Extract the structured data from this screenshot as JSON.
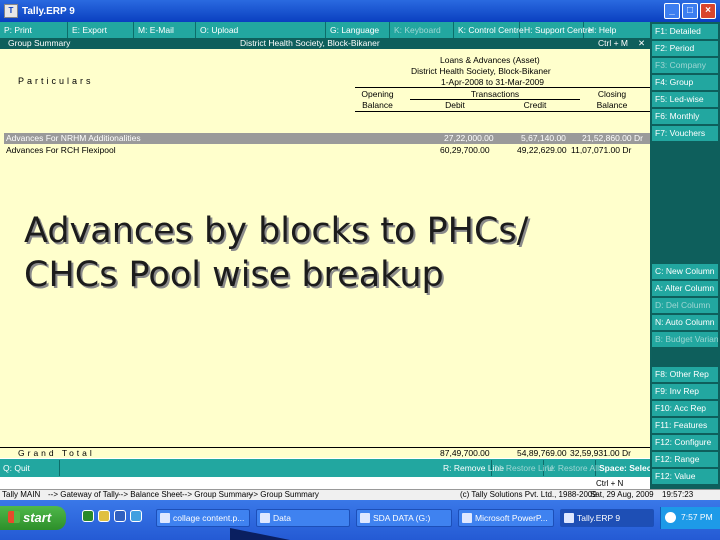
{
  "window": {
    "title": "Tally.ERP 9",
    "buttons": [
      "_",
      "□",
      "×"
    ]
  },
  "top_menu": [
    {
      "label": "P: Print",
      "dim": false
    },
    {
      "label": "E: Export",
      "dim": false
    },
    {
      "label": "M: E-Mail",
      "dim": false
    },
    {
      "label": "O: Upload",
      "dim": false
    },
    {
      "label": "G: Language",
      "dim": false
    },
    {
      "label": "K: Keyboard",
      "dim": true
    },
    {
      "label": "K: Control Centre",
      "dim": false
    },
    {
      "label": "H: Support Centre",
      "dim": false
    },
    {
      "label": "H: Help",
      "dim": false
    }
  ],
  "report_header": {
    "left": "Group Summary",
    "center": "District Health Society, Block-Bikaner",
    "right": "Ctrl + M",
    "close": "✕"
  },
  "report": {
    "particulars_label": "Particulars",
    "group_title": "Loans & Advances (Asset)",
    "company": "District Health Society, Block-Bikaner",
    "period": "1-Apr-2008 to 31-Mar-2009",
    "col_opening_1": "Opening",
    "col_opening_2": "Balance",
    "col_transactions": "Transactions",
    "col_debit": "Debit",
    "col_credit": "Credit",
    "col_closing_1": "Closing",
    "col_closing_2": "Balance",
    "rows": [
      {
        "name": "Advances For NRHM Additionalities",
        "debit": "27,22,000.00",
        "credit": "5,67,140.00",
        "closing": "21,52,860.00 Dr"
      },
      {
        "name": "Advances For RCH Flexipool",
        "debit": "60,29,700.00",
        "credit": "49,22,629.00",
        "closing": "11,07,071.00 Dr"
      }
    ],
    "overlay_line1": "Advances by blocks to PHCs/",
    "overlay_line2": "CHCs Pool wise breakup"
  },
  "grand_total": {
    "label": "Grand Total",
    "debit": "87,49,700.00",
    "credit": "54,89,769.00",
    "closing": "32,59,931.00 Dr"
  },
  "bottom_bar": [
    {
      "label": "Q: Quit",
      "dim": false
    },
    {
      "label": "R: Remove Line",
      "dim": false
    },
    {
      "label": "U: Restore Line",
      "dim": true
    },
    {
      "label": "U: Restore All",
      "dim": true
    },
    {
      "label": "Space: Select",
      "dim": false
    }
  ],
  "bottom_hint": "Ctrl + N",
  "status_line": {
    "left": "Tally MAIN",
    "crumbs": [
      "--> Gateway of Tally",
      "--> Balance Sheet",
      "--> Group Summary",
      "--> Group Summary"
    ],
    "right": "(c) Tally Solutions Pvt. Ltd., 1988-2009",
    "date": "Sat, 29 Aug, 2009",
    "time": "19:57:23"
  },
  "right_panel_top": [
    {
      "label": "F1: Detailed",
      "dim": false
    },
    {
      "label": "F2: Period",
      "dim": false
    },
    {
      "label": "F3: Company",
      "dim": true
    },
    {
      "label": "F4: Group",
      "dim": false
    },
    {
      "label": "F5: Led-wise",
      "dim": false
    },
    {
      "label": "F6: Monthly",
      "dim": false
    },
    {
      "label": "F7: Vouchers",
      "dim": false
    }
  ],
  "right_panel_mid": [
    {
      "label": "C: New Column",
      "dim": false
    },
    {
      "label": "A: Alter Column",
      "dim": false
    },
    {
      "label": "D: Del Column",
      "dim": true
    },
    {
      "label": "N: Auto Column",
      "dim": false
    },
    {
      "label": "B: Budget Variance",
      "dim": true
    }
  ],
  "right_panel_bottom": [
    {
      "label": "F8: Other Rep",
      "dim": false
    },
    {
      "label": "F9: Inv Rep",
      "dim": false
    },
    {
      "label": "F10: Acc Rep",
      "dim": false
    },
    {
      "label": "F11: Features",
      "dim": false
    },
    {
      "label": "F12: Configure",
      "dim": false
    },
    {
      "label": "F12: Range",
      "dim": false
    },
    {
      "label": "F12: Value",
      "dim": false
    }
  ],
  "taskbar": {
    "start_label": "start",
    "tasks": [
      {
        "label": "collage content.p...",
        "active": false
      },
      {
        "label": "Data",
        "active": false
      },
      {
        "label": "SDA DATA (G:)",
        "active": false
      },
      {
        "label": "Microsoft PowerP...",
        "active": false
      },
      {
        "label": "Tally.ERP 9",
        "active": true
      }
    ],
    "clock": "7:57 PM"
  }
}
